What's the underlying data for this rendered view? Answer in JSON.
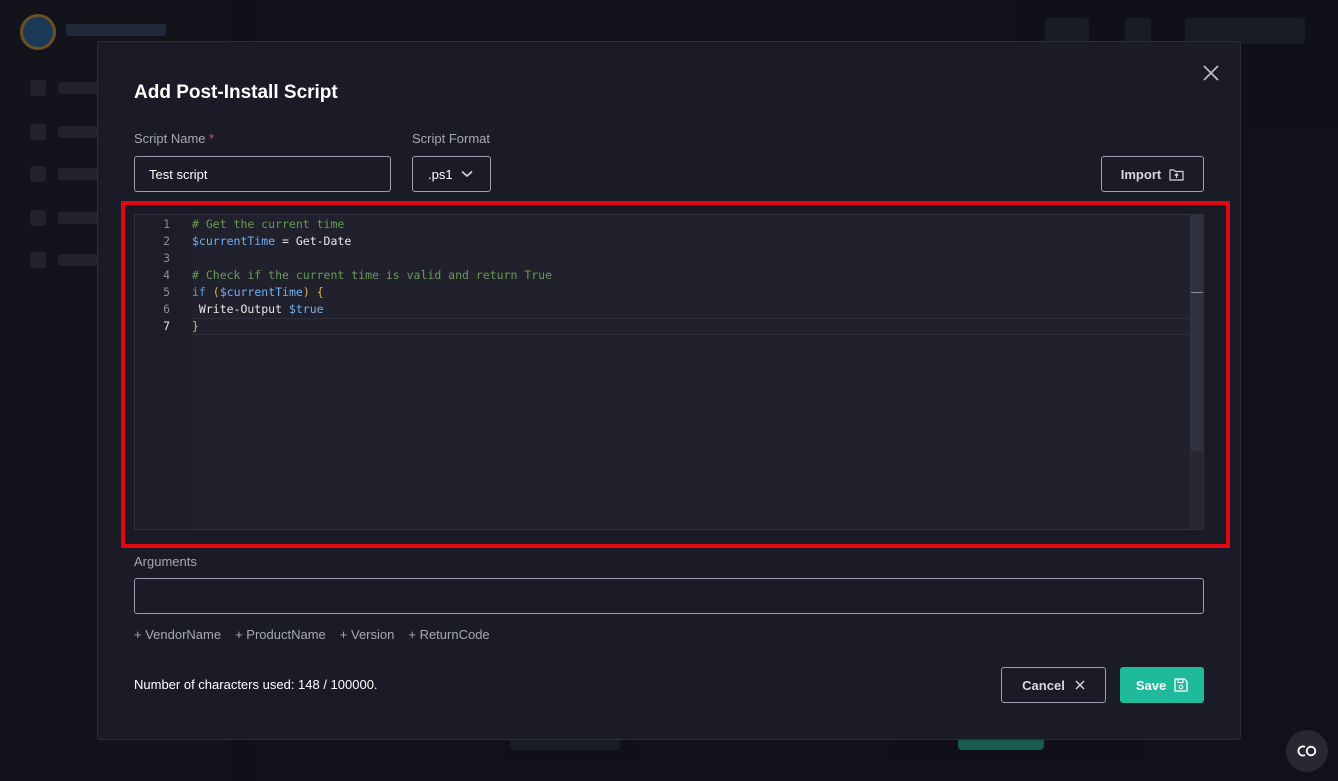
{
  "modal": {
    "title": "Add Post-Install Script",
    "script_name_label": "Script Name",
    "required_marker": "*",
    "script_name_value": "Test script",
    "script_format_label": "Script Format",
    "script_format_value": ".ps1",
    "import_label": "Import",
    "arguments_label": "Arguments",
    "arguments_value": "",
    "tokens": [
      "+ VendorName",
      "+ ProductName",
      "+ Version",
      "+ ReturnCode"
    ],
    "char_count_text": "Number of characters used: 148 / 100000.",
    "cancel_label": "Cancel",
    "save_label": "Save"
  },
  "editor": {
    "language": "powershell",
    "active_line": 7,
    "line_numbers": [
      "1",
      "2",
      "3",
      "4",
      "5",
      "6",
      "7"
    ],
    "lines": [
      "# Get the current time",
      "$currentTime = Get-Date",
      "",
      "# Check if the current time is valid and return True",
      "if ($currentTime) {",
      " Write-Output $true",
      "}"
    ]
  },
  "colors": {
    "accent": "#1fba9a",
    "highlight_border": "#e30613",
    "required": "#e0445a",
    "comment": "#6a9955",
    "variable": "#70b0f0",
    "keyword": "#569cd6",
    "bracket": "#e0b44a"
  },
  "icons": {
    "close": "close-icon",
    "chevron": "chevron-down-icon",
    "import": "folder-upload-icon",
    "cancel": "x-icon",
    "save": "floppy-disk-icon",
    "chat": "chat-widget-icon"
  }
}
